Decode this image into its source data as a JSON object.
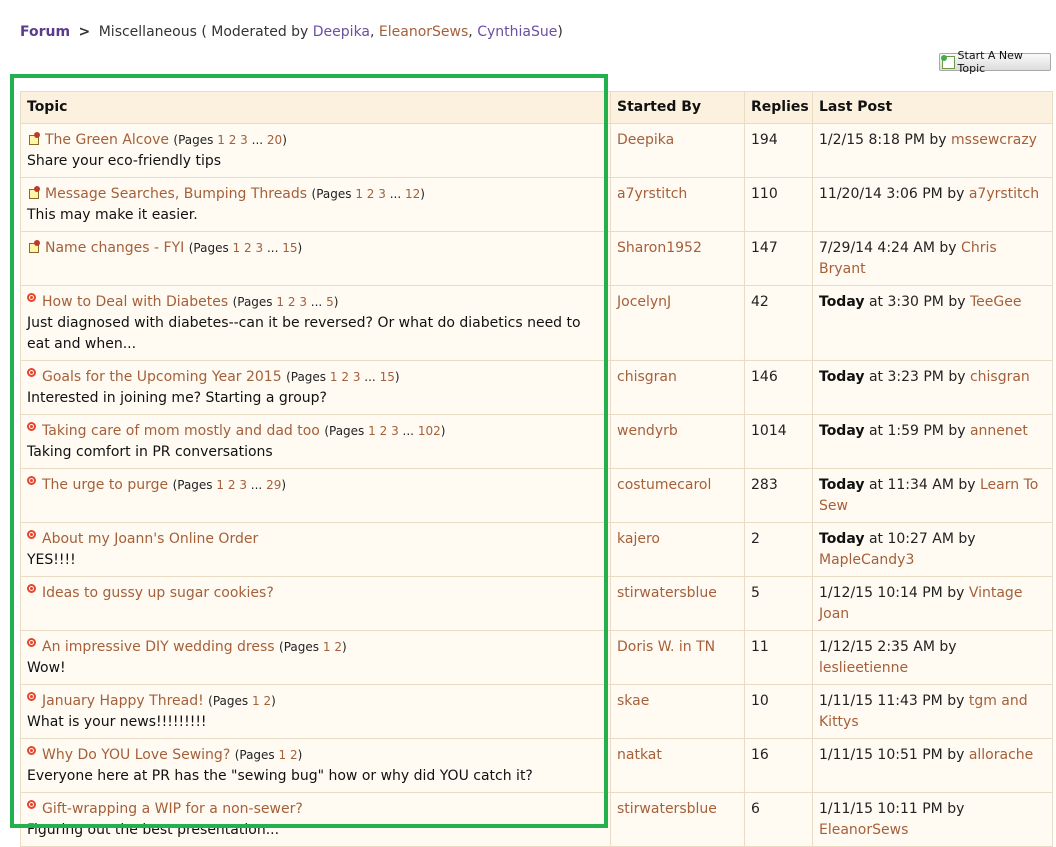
{
  "breadcrumb": {
    "forum": "Forum",
    "separator": ">",
    "current": "Miscellaneous",
    "moderated_prefix": " ( Moderated by ",
    "moderators": [
      "Deepika",
      "EleanorSews",
      "CynthiaSue"
    ],
    "comma": ", ",
    "suffix": ")"
  },
  "new_topic_button": "Start A New Topic",
  "columns": [
    "Topic",
    "Started By",
    "Replies",
    "Last Post"
  ],
  "by_text": " by ",
  "rows": [
    {
      "sticky": true,
      "title": "The Green Alcove",
      "pages": [
        "1",
        "2",
        "3",
        "...",
        "20"
      ],
      "desc": "Share your eco-friendly tips",
      "starter": "Deepika",
      "replies": "194",
      "last_date": "1/2/15 8:18 PM",
      "last_today": false,
      "last_by": "mssewcrazy"
    },
    {
      "sticky": true,
      "title": "Message Searches, Bumping Threads",
      "pages": [
        "1",
        "2",
        "3",
        "...",
        "12"
      ],
      "desc": "This may make it easier.",
      "starter": "a7yrstitch",
      "replies": "110",
      "last_date": "11/20/14 3:06 PM",
      "last_today": false,
      "last_by": "a7yrstitch"
    },
    {
      "sticky": true,
      "title": "Name changes - FYI",
      "pages": [
        "1",
        "2",
        "3",
        "...",
        "15"
      ],
      "desc": "",
      "starter": "Sharon1952",
      "replies": "147",
      "last_date": "7/29/14 4:24 AM",
      "last_today": false,
      "last_by": "Chris Bryant"
    },
    {
      "sticky": false,
      "title": "How to Deal with Diabetes",
      "pages": [
        "1",
        "2",
        "3",
        "...",
        "5"
      ],
      "desc": "Just diagnosed with diabetes--can it be reversed? Or what do diabetics need to eat and when...",
      "starter": "JocelynJ",
      "replies": "42",
      "last_date": "at 3:30 PM",
      "last_today": true,
      "last_by": "TeeGee"
    },
    {
      "sticky": false,
      "title": "Goals for the Upcoming Year 2015",
      "pages": [
        "1",
        "2",
        "3",
        "...",
        "15"
      ],
      "desc": "Interested in joining me? Starting a group?",
      "starter": "chisgran",
      "replies": "146",
      "last_date": "at 3:23 PM",
      "last_today": true,
      "last_by": "chisgran"
    },
    {
      "sticky": false,
      "title": "Taking care of mom mostly and dad too",
      "pages": [
        "1",
        "2",
        "3",
        "...",
        "102"
      ],
      "desc": "Taking comfort in PR conversations",
      "starter": "wendyrb",
      "replies": "1014",
      "last_date": "at 1:59 PM",
      "last_today": true,
      "last_by": "annenet"
    },
    {
      "sticky": false,
      "title": "The urge to purge",
      "pages": [
        "1",
        "2",
        "3",
        "...",
        "29"
      ],
      "desc": "",
      "starter": "costumecarol",
      "replies": "283",
      "last_date": "at 11:34 AM",
      "last_today": true,
      "last_by": "Learn To Sew"
    },
    {
      "sticky": false,
      "title": "About my Joann's Online Order",
      "pages": [],
      "desc": "YES!!!!",
      "starter": "kajero",
      "replies": "2",
      "last_date": "at 10:27 AM",
      "last_today": true,
      "last_by": "MapleCandy3"
    },
    {
      "sticky": false,
      "title": "Ideas to gussy up sugar cookies?",
      "pages": [],
      "desc": "",
      "starter": "stirwatersblue",
      "replies": "5",
      "last_date": "1/12/15 10:14 PM",
      "last_today": false,
      "last_by": "Vintage Joan"
    },
    {
      "sticky": false,
      "title": "An impressive DIY wedding dress",
      "pages": [
        "1",
        "2"
      ],
      "desc": "Wow!",
      "starter": "Doris W. in TN",
      "replies": "11",
      "last_date": "1/12/15 2:35 AM",
      "last_today": false,
      "last_by": "leslieetienne"
    },
    {
      "sticky": false,
      "title": "January Happy Thread!",
      "pages": [
        "1",
        "2"
      ],
      "desc": "What is your news!!!!!!!!!",
      "starter": "skae",
      "replies": "10",
      "last_date": "1/11/15 11:43 PM",
      "last_today": false,
      "last_by": "tgm and Kittys"
    },
    {
      "sticky": false,
      "title": "Why Do YOU Love Sewing?",
      "pages": [
        "1",
        "2"
      ],
      "desc": "Everyone here at PR has the \"sewing bug\" how or why did YOU catch it?",
      "starter": "natkat",
      "replies": "16",
      "last_date": "1/11/15 10:51 PM",
      "last_today": false,
      "last_by": "allorache"
    },
    {
      "sticky": false,
      "title": "Gift-wrapping a WIP for a non-sewer?",
      "pages": [],
      "desc": "Figuring out the best presentation...",
      "starter": "stirwatersblue",
      "replies": "6",
      "last_date": "1/11/15 10:11 PM",
      "last_today": false,
      "last_by": "EleanorSews"
    }
  ],
  "today_label": "Today",
  "pages_prefix": "(Pages ",
  "pages_suffix": ")"
}
